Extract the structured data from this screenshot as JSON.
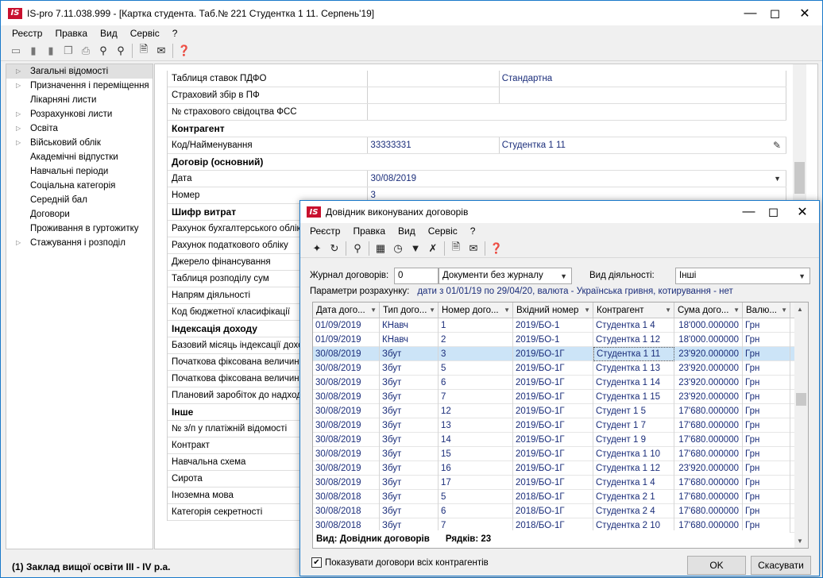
{
  "window": {
    "title": "IS-pro 7.11.038.999 - [Картка студента. Таб.№ 221 Студентка 1 11. Серпень'19]",
    "logo_text": "IS"
  },
  "menubar": [
    "Реєстр",
    "Правка",
    "Вид",
    "Сервіс",
    "?"
  ],
  "toolbar_icons": [
    "copy-icon",
    "paste-icon",
    "paste-special-icon",
    "duplicate-icon",
    "print-icon",
    "search-icon",
    "search-next-icon",
    "document-icon",
    "mail-icon",
    "help-icon"
  ],
  "left_nav": [
    {
      "label": "Загальні відомості",
      "expand": true,
      "selected": true
    },
    {
      "label": "Призначення і переміщення",
      "expand": true
    },
    {
      "label": "Лікарняні листи",
      "expand": false
    },
    {
      "label": "Розрахункові листи",
      "expand": true
    },
    {
      "label": "Освіта",
      "expand": true
    },
    {
      "label": "Військовий облік",
      "expand": true
    },
    {
      "label": "Академічні відпустки",
      "expand": false
    },
    {
      "label": "Навчальні періоди",
      "expand": false
    },
    {
      "label": "Соціальна категорія",
      "expand": false
    },
    {
      "label": "Середній бал",
      "expand": false
    },
    {
      "label": "Договори",
      "expand": false
    },
    {
      "label": "Проживання в гуртожитку",
      "expand": false
    },
    {
      "label": "Стажування і розподіл",
      "expand": true
    }
  ],
  "form": {
    "rows": [
      {
        "type": "field",
        "label": "Таблиця ставок ПДФО",
        "v1": "",
        "v2": "Стандартна"
      },
      {
        "type": "field",
        "label": "Страховий збір в ПФ",
        "v1": "",
        "v2": ""
      },
      {
        "type": "wide",
        "label": "№ страхового свідоцтва ФСС",
        "v": ""
      },
      {
        "type": "section",
        "label": "Контрагент"
      },
      {
        "type": "field",
        "label": "Код/Найменування",
        "v1": "33333331",
        "v2": "Студентка 1 11",
        "edit": true
      },
      {
        "type": "section",
        "label": "Договір (основний)"
      },
      {
        "type": "wide",
        "label": "Дата",
        "v": "30/08/2019",
        "dropdown": true
      },
      {
        "type": "wide",
        "label": "Номер",
        "v": "3"
      },
      {
        "type": "section",
        "label": "Шифр витрат"
      },
      {
        "type": "wide",
        "label": "Рахунок бухгалтерського обліку",
        "v": ""
      },
      {
        "type": "wide",
        "label": "Рахунок податкового обліку",
        "v": ""
      },
      {
        "type": "wide",
        "label": "Джерело фінансування",
        "v": ""
      },
      {
        "type": "wide",
        "label": "Таблиця розподілу сум",
        "v": ""
      },
      {
        "type": "wide",
        "label": "Напрям діяльності",
        "v": ""
      },
      {
        "type": "wide",
        "label": "Код бюджетної класифікації",
        "v": ""
      },
      {
        "type": "section",
        "label": "Індексація доходу"
      },
      {
        "type": "wide",
        "label": "Базовий місяць індексації доходу",
        "v": ""
      },
      {
        "type": "wide",
        "label": "Початкова фіксована величина",
        "v": ""
      },
      {
        "type": "wide",
        "label": "Початкова фіксована величина",
        "v": ""
      },
      {
        "type": "wide",
        "label": "Плановий заробіток до надходження",
        "v": ""
      },
      {
        "type": "section",
        "label": "Інше"
      },
      {
        "type": "wide",
        "label": "№ з/п  у платіжній відомості",
        "v": ""
      },
      {
        "type": "wide",
        "label": "Контракт",
        "v": ""
      },
      {
        "type": "wide",
        "label": "Навчальна схема",
        "v": ""
      },
      {
        "type": "wide",
        "label": "Сирота",
        "v": ""
      },
      {
        "type": "wide",
        "label": "Іноземна мова",
        "v": ""
      },
      {
        "type": "wide",
        "label": "Категорія секретності",
        "v": ""
      }
    ]
  },
  "status": {
    "text": "(1) Заклад вищої освіти ІІІ - ІV р.а."
  },
  "dialog": {
    "title": "Довідник виконуваних договорів",
    "menubar": [
      "Реєстр",
      "Правка",
      "Вид",
      "Сервіс",
      "?"
    ],
    "toolbar_icons": [
      "new-icon",
      "refresh-icon",
      "search-icon",
      "table-icon",
      "calendar-icon",
      "filter-icon",
      "clear-filter-icon",
      "document-icon",
      "mail-icon",
      "help-icon"
    ],
    "journal_label": "Журнал договорів:",
    "journal_code": "0",
    "journal_name": "Документи без журналу",
    "activity_label": "Вид діяльності:",
    "activity_value": "Інші",
    "params_label": "Параметри розрахунку:",
    "params_value": "дати з 01/01/19 по 29/04/20, валюта - Українська гривня, котирування - нет",
    "columns": [
      "Дата дого...",
      "Тип дого...",
      "Номер дого...",
      "Вхідний номер",
      "Контрагент",
      "Сума дого...",
      "Валю..."
    ],
    "rows": [
      [
        "01/09/2019",
        "КНавч",
        "1",
        "2019/БО-1",
        "Студентка 1 4",
        "18'000.000000",
        "Грн"
      ],
      [
        "01/09/2019",
        "КНавч",
        "2",
        "2019/БО-1",
        "Студентка 1 12",
        "18'000.000000",
        "Грн"
      ],
      [
        "30/08/2019",
        "Збут",
        "3",
        "2019/БО-1Г",
        "Студентка 1 11",
        "23'920.000000",
        "Грн"
      ],
      [
        "30/08/2019",
        "Збут",
        "5",
        "2019/БО-1Г",
        "Студентка 1 13",
        "23'920.000000",
        "Грн"
      ],
      [
        "30/08/2019",
        "Збут",
        "6",
        "2019/БО-1Г",
        "Студентка 1 14",
        "23'920.000000",
        "Грн"
      ],
      [
        "30/08/2019",
        "Збут",
        "7",
        "2019/БО-1Г",
        "Студентка 1 15",
        "23'920.000000",
        "Грн"
      ],
      [
        "30/08/2019",
        "Збут",
        "12",
        "2019/БО-1Г",
        "Студент 1 5",
        "17'680.000000",
        "Грн"
      ],
      [
        "30/08/2019",
        "Збут",
        "13",
        "2019/БО-1Г",
        "Студент 1 7",
        "17'680.000000",
        "Грн"
      ],
      [
        "30/08/2019",
        "Збут",
        "14",
        "2019/БО-1Г",
        "Студент 1 9",
        "17'680.000000",
        "Грн"
      ],
      [
        "30/08/2019",
        "Збут",
        "15",
        "2019/БО-1Г",
        "Студентка 1 10",
        "17'680.000000",
        "Грн"
      ],
      [
        "30/08/2019",
        "Збут",
        "16",
        "2019/БО-1Г",
        "Студентка 1 12",
        "23'920.000000",
        "Грн"
      ],
      [
        "30/08/2019",
        "Збут",
        "17",
        "2019/БО-1Г",
        "Студентка 1 4",
        "17'680.000000",
        "Грн"
      ],
      [
        "30/08/2018",
        "Збут",
        "5",
        "2018/БО-1Г",
        "Студентка 2 1",
        "17'680.000000",
        "Грн"
      ],
      [
        "30/08/2018",
        "Збут",
        "6",
        "2018/БО-1Г",
        "Студентка 2 4",
        "17'680.000000",
        "Грн"
      ],
      [
        "30/08/2018",
        "Збут",
        "7",
        "2018/БО-1Г",
        "Студентка 2 10",
        "17'680.000000",
        "Грн"
      ]
    ],
    "selected_row": 2,
    "footer_view": "Вид: Довідник договорів",
    "footer_rows": "Рядків: 23",
    "show_all_label": "Показувати договори всіх контрагентів",
    "show_all_checked": true,
    "ok_label": "OK",
    "cancel_label": "Скасувати"
  }
}
